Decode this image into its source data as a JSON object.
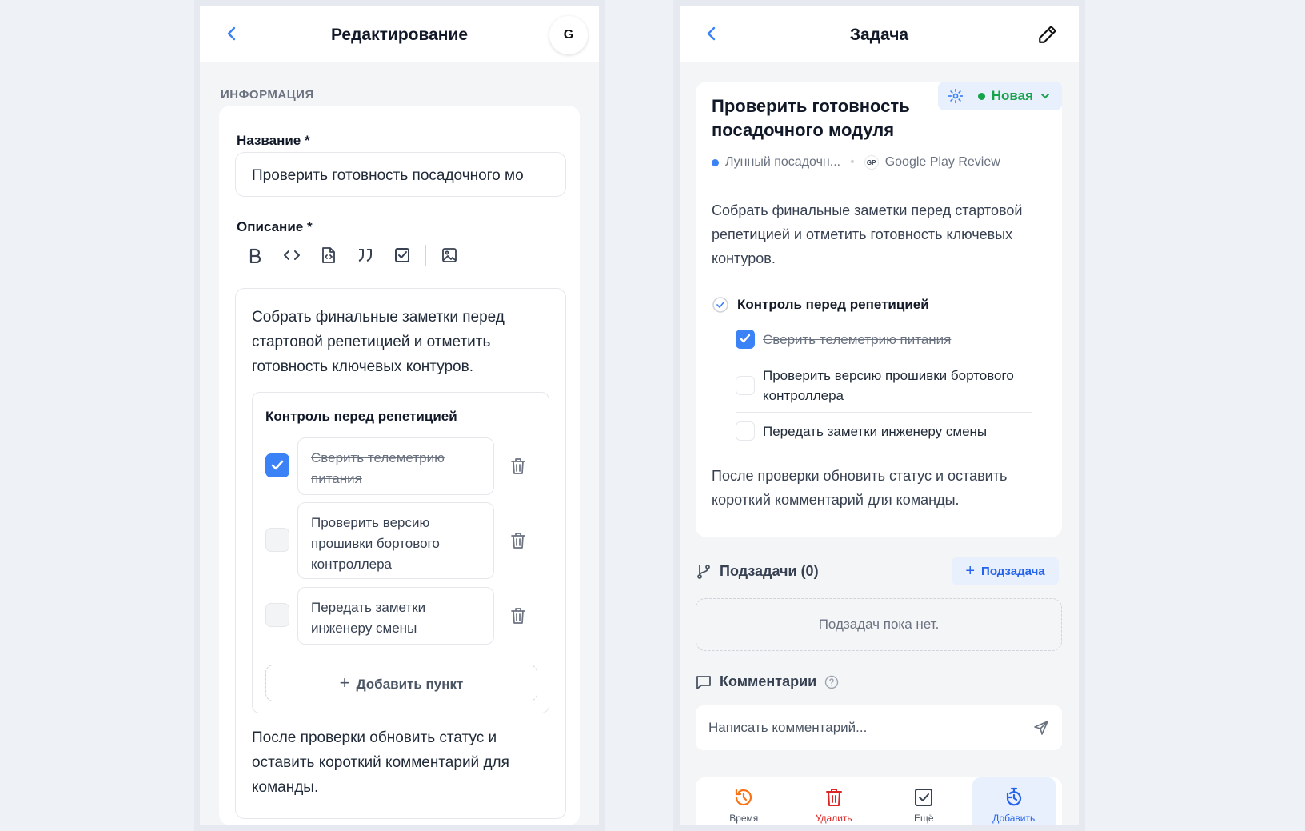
{
  "left": {
    "title": "Редактирование",
    "avatar": "G",
    "section": "ИНФОРМАЦИЯ",
    "name_label": "Название *",
    "name_value": "Проверить готовность посадочного мо",
    "desc_label": "Описание *",
    "intro": "Собрать финальные заметки перед стартовой репетицией и отметить готовность ключевых контуров.",
    "checklist_title": "Контроль перед репетицией",
    "items": [
      {
        "text": "Сверить телеметрию питания",
        "done": true
      },
      {
        "text": "Проверить версию прошивки бортового контроллера",
        "done": false
      },
      {
        "text": "Передать заметки инженеру смены",
        "done": false
      }
    ],
    "add_item": "Добавить пункт",
    "outro": "После проверки обновить статус и оставить короткий комментарий для команды."
  },
  "right": {
    "title": "Задача",
    "task_title": "Проверить готовность посадочного модуля",
    "status": "Новая",
    "project": "Лунный посадочн...",
    "source_badge": "GP",
    "source": "Google Play Review",
    "intro": "Собрать финальные заметки перед стартовой репетицией и отметить готовность ключевых контуров.",
    "checklist_title": "Контроль перед репетицией",
    "items": [
      {
        "text": "Сверить телеметрию питания",
        "done": true
      },
      {
        "text": "Проверить версию прошивки бортового контроллера",
        "done": false
      },
      {
        "text": "Передать заметки инженеру смены",
        "done": false
      }
    ],
    "outro": "После проверки обновить статус и оставить короткий комментарий для команды.",
    "subtasks_label": "Подзадачи (0)",
    "add_subtask": "Подзадача",
    "subtasks_empty": "Подзадач пока нет.",
    "comments_label": "Комментарии",
    "comment_placeholder": "Написать комментарий...",
    "actions": [
      "Время",
      "Удалить",
      "Ещё",
      "Добавить"
    ]
  },
  "colors": {
    "accent": "#3b82f6",
    "status": "#16a34a",
    "danger": "#dc2626",
    "page_bg": "#eef2f7"
  }
}
